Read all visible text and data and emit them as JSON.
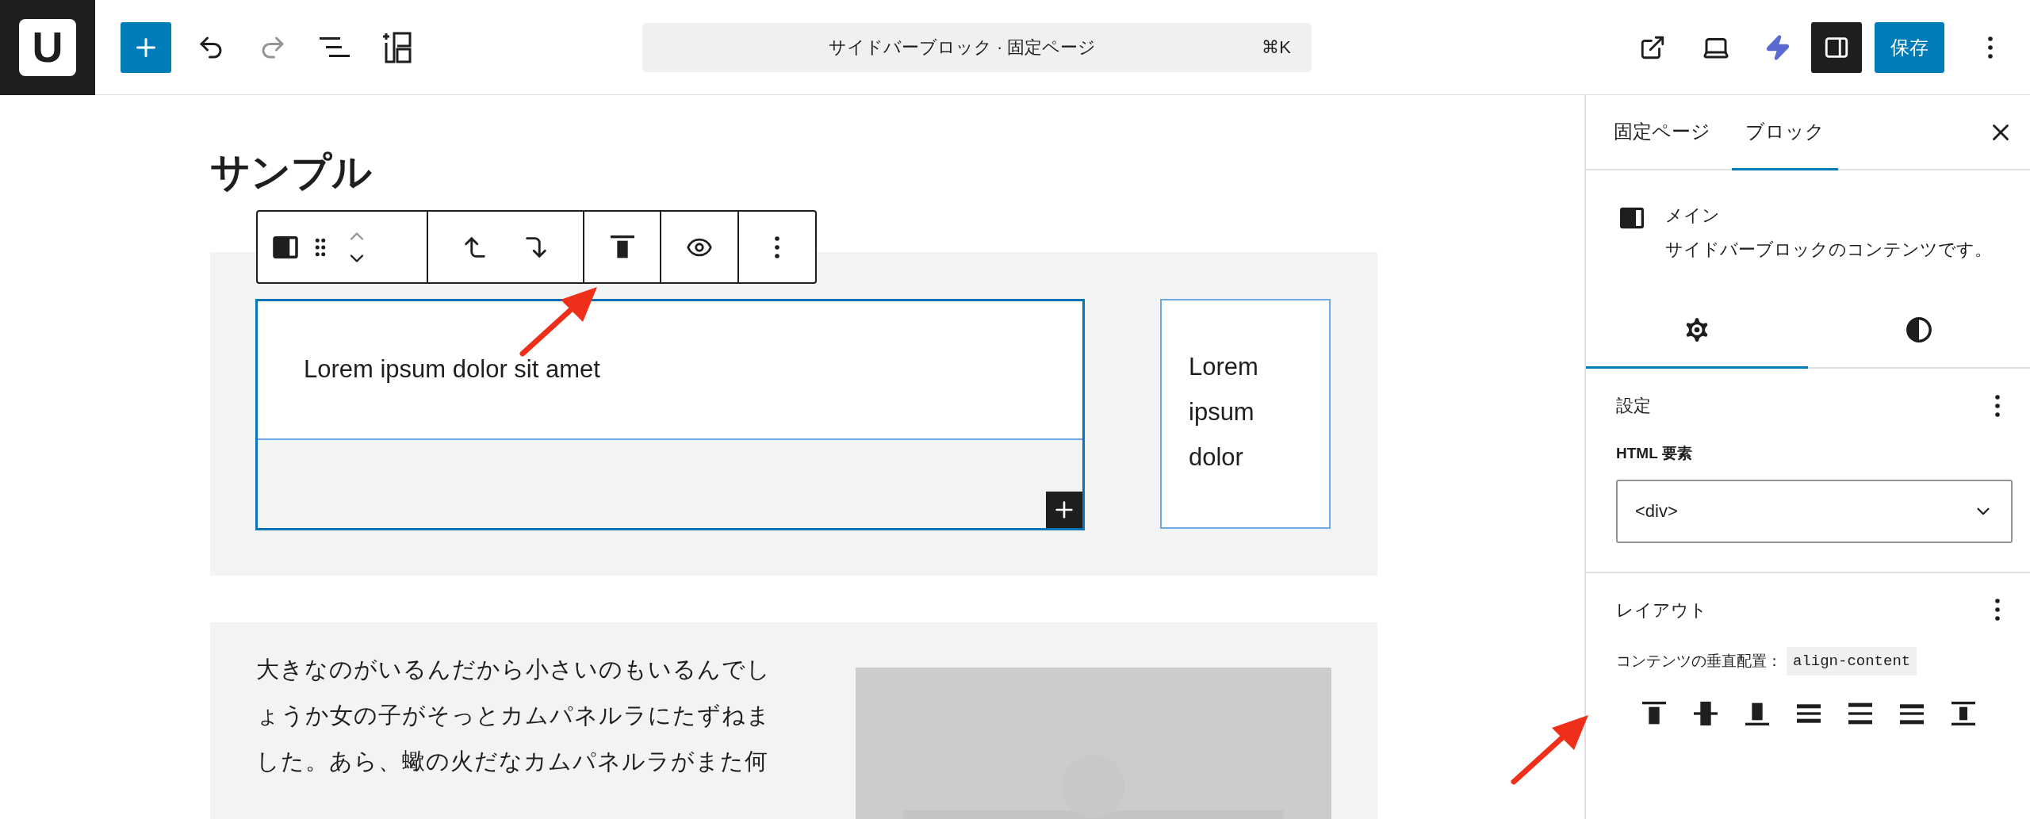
{
  "topbar": {
    "logo": "U",
    "redo": {
      "disabled": true
    },
    "command": {
      "title": "サイドバーブロック · 固定ページ",
      "shortcut": "⌘K"
    },
    "sidebar_toggle": {
      "on": true
    },
    "save": "保存"
  },
  "editor": {
    "title": "サンプル",
    "group1": {
      "main_text": "Lorem ipsum dolor sit amet",
      "side_text": "Lorem ipsum dolor"
    },
    "group2": {
      "text": "大きなのがいるんだから小さいのもいるんでしょうか女の子がそっとカムパネルラにたずねました。あら、蠍の火だなカムパネルラがまた何"
    }
  },
  "sidebar": {
    "tabs": [
      {
        "label": "固定ページ",
        "selected": false
      },
      {
        "label": "ブロック",
        "selected": true
      }
    ],
    "block": {
      "name": "メイン",
      "description": "サイドバーブロックのコンテンツです。"
    },
    "inspector_tabs": [
      {
        "kind": "settings",
        "selected": true
      },
      {
        "kind": "styles",
        "selected": false
      }
    ],
    "settings": {
      "title": "設定",
      "field_label": "HTML 要素",
      "select_value": "<div>"
    },
    "layout": {
      "title": "レイアウト",
      "label": "コンテンツの垂直配置：",
      "code": "align-content",
      "align_buttons": [
        {
          "kind": "top"
        },
        {
          "kind": "center"
        },
        {
          "kind": "bottom"
        },
        {
          "kind": "between"
        },
        {
          "kind": "around"
        },
        {
          "kind": "evenly"
        },
        {
          "kind": "stretch"
        }
      ]
    }
  }
}
